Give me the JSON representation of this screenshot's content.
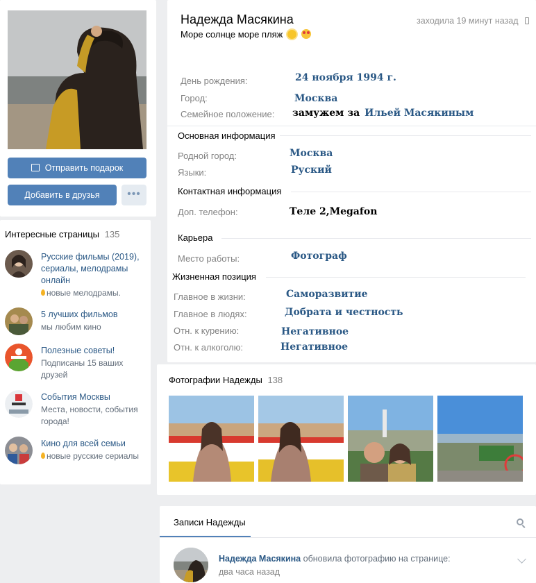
{
  "avatar_card": {
    "gift_button": "Отправить подарок",
    "add_friend_button": "Добавить в друзья",
    "more_button": "•••"
  },
  "interesting_pages": {
    "title": "Интересные страницы",
    "count": "135",
    "items": [
      {
        "name": "Русские фильмы (2019), сериалы, мелодрамы онлайн",
        "sub": "новые мелодрамы.",
        "has_drop": true
      },
      {
        "name": "5 лучших фильмов",
        "sub": "мы любим кино",
        "has_drop": false
      },
      {
        "name": "Полезные советы!",
        "sub": "Подписаны 15 ваших друзей",
        "has_drop": false
      },
      {
        "name": "События Москвы",
        "sub": "Места, новости, события города!",
        "has_drop": false
      },
      {
        "name": "Кино для всей семьи",
        "sub": "новые русские сериалы",
        "has_drop": true
      }
    ]
  },
  "profile": {
    "name": "Надежда Масякина",
    "status": "Море солнце море пляж",
    "last_seen": "заходила 19 минут назад",
    "birthday_label": "День рождения:",
    "birthday_value": "24 ноября 1994 г.",
    "city_label": "Город:",
    "city_value": "Москва",
    "family_label": "Семейное положение:",
    "family_value_prefix": "замужем за",
    "family_value_link": "Ильей Масякиным",
    "main_info_title": "Основная информация",
    "hometown_label": "Родной город:",
    "hometown_value": "Москва",
    "languages_label": "Языки:",
    "languages_value": "Руский",
    "contact_title": "Контактная информация",
    "phone_label": "Доп. телефон:",
    "phone_value": "Теле 2,Megafon",
    "career_title": "Карьера",
    "work_label": "Место работы:",
    "work_value": "Фотограф",
    "life_title": "Жизненная позиция",
    "life_main_label": "Главное в жизни:",
    "life_main_value": "Саморазвитие",
    "people_main_label": "Главное в людях:",
    "people_main_value": "Добрата и честность",
    "smoking_label": "Отн. к курению:",
    "smoking_value": "Негативное",
    "alcohol_label": "Отн. к алкоголю:",
    "alcohol_value": "Негативное"
  },
  "photos": {
    "title": "Фотографии Надежды",
    "count": "138"
  },
  "posts": {
    "tab": "Записи Надежды",
    "author": "Надежда Масякина",
    "action": "обновила фотографию на странице:",
    "time": "два часа назад"
  },
  "colors": {
    "accent": "#5181b8",
    "link": "#2a5885",
    "background": "#edeef0"
  }
}
